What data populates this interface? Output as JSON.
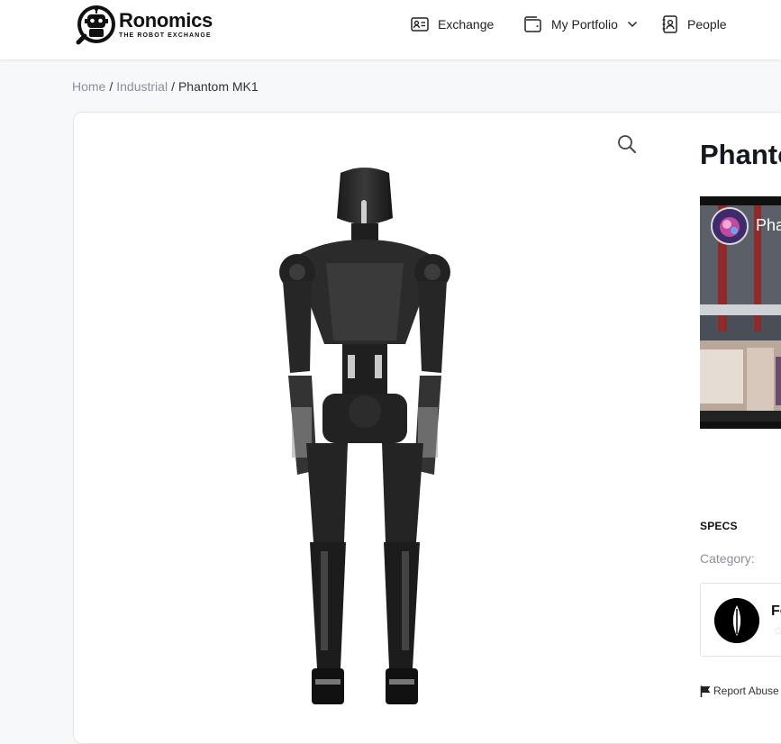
{
  "brand": {
    "name": "Ronomics",
    "tagline": "THE ROBOT EXCHANGE"
  },
  "nav": [
    {
      "label": "Exchange",
      "icon": "id-card-icon"
    },
    {
      "label": "My Portfolio",
      "icon": "wallet-icon",
      "has_dropdown": true
    },
    {
      "label": "People",
      "icon": "contact-book-icon"
    }
  ],
  "breadcrumb": {
    "items": [
      "Home",
      "Industrial"
    ],
    "current": "Phantom MK1",
    "separator": "/"
  },
  "product": {
    "title": "Phanto",
    "video": {
      "title": "Pha"
    },
    "specs_label": "SPECS",
    "category_label": "Category:",
    "seller": {
      "name": "Fo",
      "rating_icon": "star-outline-icon"
    },
    "report_label": "Report Abuse"
  },
  "colors": {
    "accent": "#111111",
    "background": "#f7f8fa",
    "muted_text": "#8a8f98"
  }
}
